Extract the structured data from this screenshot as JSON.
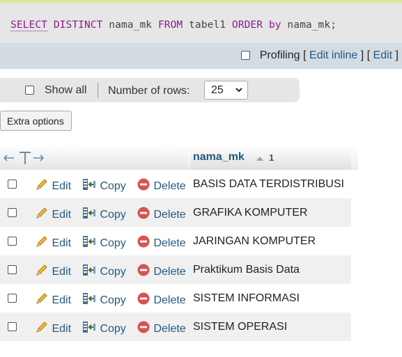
{
  "query": {
    "tokens": [
      {
        "text": "SELECT",
        "type": "keyword"
      },
      {
        "text": " ",
        "type": "plain"
      },
      {
        "text": "DISTINCT",
        "type": "keyword"
      },
      {
        "text": " nama_mk ",
        "type": "plain"
      },
      {
        "text": "FROM",
        "type": "keyword"
      },
      {
        "text": " tabel1 ",
        "type": "plain"
      },
      {
        "text": "ORDER",
        "type": "keyword"
      },
      {
        "text": " ",
        "type": "plain"
      },
      {
        "text": "by",
        "type": "keyword"
      },
      {
        "text": " nama_mk;",
        "type": "plain"
      }
    ]
  },
  "profiling": {
    "label": "Profiling",
    "open_bracket": "[",
    "edit_inline": "Edit inline",
    "mid": "] [",
    "edit": "Edit",
    "close_bracket": "]"
  },
  "navigation": {
    "show_all_label": "Show all",
    "num_rows_label": "Number of rows:",
    "num_rows_value": "25"
  },
  "extra_options_label": "Extra options",
  "table": {
    "column": {
      "name": "nama_mk",
      "sort_index": "1"
    },
    "actions": {
      "edit": "Edit",
      "copy": "Copy",
      "delete": "Delete"
    },
    "rows": [
      {
        "nama_mk": "BASIS DATA TERDISTRIBUSI"
      },
      {
        "nama_mk": "GRAFIKA KOMPUTER"
      },
      {
        "nama_mk": "JARINGAN KOMPUTER"
      },
      {
        "nama_mk": "Praktikum Basis Data"
      },
      {
        "nama_mk": "SISTEM INFORMASI"
      },
      {
        "nama_mk": "SISTEM OPERASI"
      }
    ]
  },
  "colors": {
    "keyword": "#8b1b8b",
    "link": "#235a81",
    "profiling_bar": "#d3dce3",
    "delete_icon": "#d9534f"
  }
}
